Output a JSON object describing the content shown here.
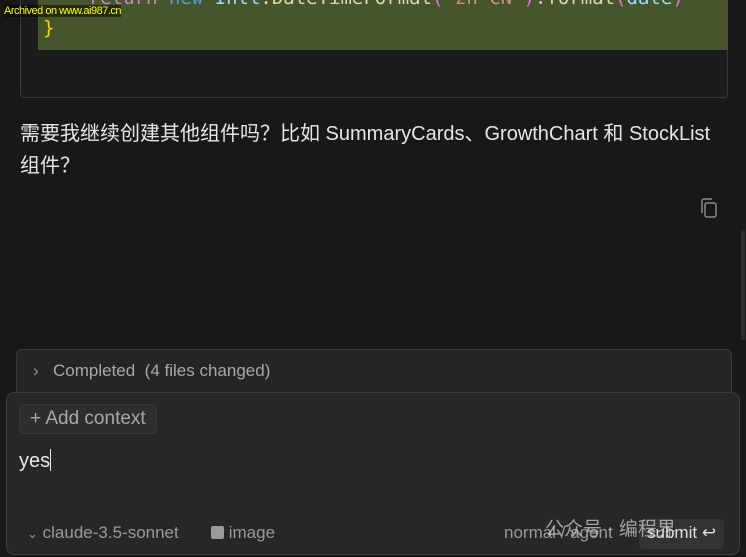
{
  "watermark": "Archived on www.ai987.cn",
  "code": {
    "line1": {
      "kw": "return",
      "kw2": "new",
      "obj": "Intl",
      "fn": "DateTimeFormat",
      "arg": "'zh-CN'",
      "fn2": "format",
      "arg2": "date"
    },
    "brace": "}"
  },
  "message": "需要我继续创建其他组件吗？比如 SummaryCards、GrowthChart 和 StockList 组件？",
  "completed": {
    "label": "Completed",
    "detail": "(4 files changed)"
  },
  "composer": {
    "add_context": "Add context",
    "value": "yes",
    "model": "claude-3.5-sonnet",
    "image": "image",
    "mode": "normal / agent",
    "submit": "submit"
  },
  "overlay_watermark": "公众号 · 编程界"
}
